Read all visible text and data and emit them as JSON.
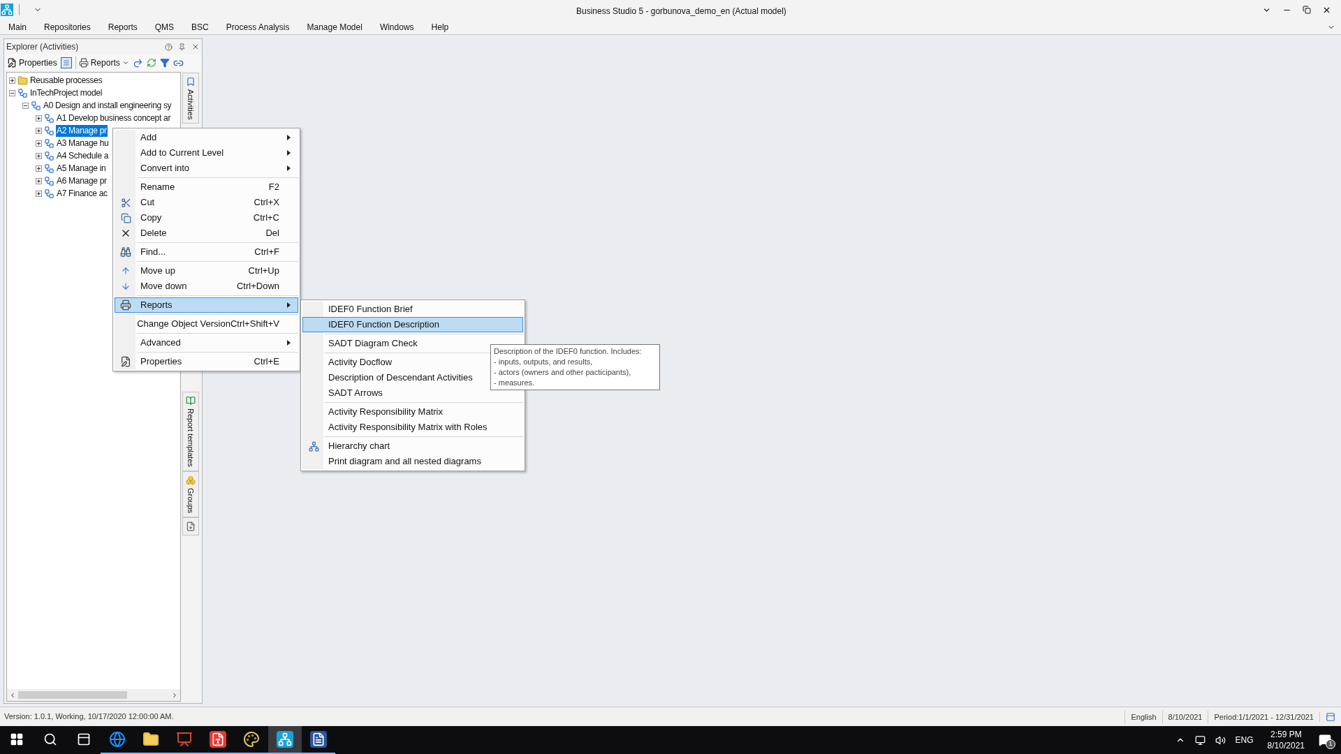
{
  "window": {
    "title": "Business Studio 5 - gorbunova_demo_en (Actual model)"
  },
  "menu_bar": [
    "Main",
    "Repositories",
    "Reports",
    "QMS",
    "BSC",
    "Process Analysis",
    "Manage Model",
    "Windows",
    "Help"
  ],
  "explorer": {
    "title": "Explorer (Activities)",
    "toolbar": [
      {
        "kind": "button",
        "label": "Properties"
      },
      {
        "kind": "icon"
      },
      {
        "kind": "dropdown",
        "label": "Reports"
      },
      {
        "kind": "icon"
      },
      {
        "kind": "icon"
      },
      {
        "kind": "icon"
      },
      {
        "kind": "icon"
      }
    ],
    "tree": [
      {
        "label": "Reusable processes",
        "expanded": false,
        "selected": false
      },
      {
        "label": "InTechProject model",
        "expanded": true,
        "selected": false,
        "children": [
          {
            "label": "A0 Design and install engineering sy",
            "expanded": true,
            "selected": false,
            "children": [
              {
                "label": "A1 Develop business concept ar",
                "expanded": false,
                "selected": false
              },
              {
                "label": "A2 Manage pr",
                "expanded": false,
                "selected": true
              },
              {
                "label": "A3 Manage hu",
                "expanded": false,
                "selected": false
              },
              {
                "label": "A4 Schedule a",
                "expanded": false,
                "selected": false
              },
              {
                "label": "A5 Manage in",
                "expanded": false,
                "selected": false
              },
              {
                "label": "A6 Manage pr",
                "expanded": false,
                "selected": false
              },
              {
                "label": "A7 Finance ac",
                "expanded": false,
                "selected": false
              }
            ]
          }
        ]
      }
    ],
    "side_tabs": [
      {
        "label": "Activities"
      },
      {
        "label": "Report templates"
      },
      {
        "label": "Groups"
      }
    ]
  },
  "context_menu": [
    {
      "kind": "item",
      "label": "Add",
      "submenu": true,
      "selected": false
    },
    {
      "kind": "item",
      "label": "Add to Current Level",
      "submenu": true,
      "selected": false
    },
    {
      "kind": "item",
      "label": "Convert into",
      "submenu": true,
      "selected": false
    },
    {
      "kind": "separator"
    },
    {
      "kind": "item",
      "label": "Rename",
      "shortcut": "F2",
      "selected": false
    },
    {
      "kind": "item",
      "label": "Cut",
      "shortcut": "Ctrl+X",
      "selected": false
    },
    {
      "kind": "item",
      "label": "Copy",
      "shortcut": "Ctrl+C",
      "selected": false
    },
    {
      "kind": "item",
      "label": "Delete",
      "shortcut": "Del",
      "selected": false
    },
    {
      "kind": "separator"
    },
    {
      "kind": "item",
      "label": "Find...",
      "shortcut": "Ctrl+F",
      "selected": false
    },
    {
      "kind": "separator"
    },
    {
      "kind": "item",
      "label": "Move up",
      "shortcut": "Ctrl+Up",
      "selected": false
    },
    {
      "kind": "item",
      "label": "Move down",
      "shortcut": "Ctrl+Down",
      "selected": false
    },
    {
      "kind": "separator"
    },
    {
      "kind": "item",
      "label": "Reports",
      "submenu": true,
      "selected": true
    },
    {
      "kind": "separator"
    },
    {
      "kind": "item",
      "label": "Change Object Version",
      "shortcut": "Ctrl+Shift+V",
      "selected": false
    },
    {
      "kind": "separator"
    },
    {
      "kind": "item",
      "label": "Advanced",
      "submenu": true,
      "selected": false
    },
    {
      "kind": "separator"
    },
    {
      "kind": "item",
      "label": "Properties",
      "shortcut": "Ctrl+E",
      "selected": false
    }
  ],
  "reports_submenu": [
    {
      "kind": "item",
      "label": "IDEF0 Function Brief",
      "selected": false
    },
    {
      "kind": "item",
      "label": "IDEF0 Function Description",
      "selected": true
    },
    {
      "kind": "separator"
    },
    {
      "kind": "item",
      "label": "SADT Diagram Check",
      "selected": false
    },
    {
      "kind": "separator"
    },
    {
      "kind": "item",
      "label": "Activity Docflow",
      "selected": false
    },
    {
      "kind": "item",
      "label": "Description of Descendant Activities",
      "selected": false
    },
    {
      "kind": "item",
      "label": "SADT Arrows",
      "selected": false
    },
    {
      "kind": "separator"
    },
    {
      "kind": "item",
      "label": "Activity Responsibility Matrix",
      "selected": false
    },
    {
      "kind": "item",
      "label": "Activity Responsibility Matrix with Roles",
      "selected": false
    },
    {
      "kind": "separator"
    },
    {
      "kind": "item",
      "label": "Hierarchy chart",
      "selected": false
    },
    {
      "kind": "item",
      "label": "Print diagram and all nested diagrams",
      "selected": false
    }
  ],
  "tooltip": [
    "Description of the IDEF0 function. Includes:",
    "- inputs, outputs, and results,",
    "- actors (owners and other pacticipants),",
    "- measures."
  ],
  "status_bar": {
    "text": "Version: 1.0.1, Working, 10/17/2020 12:00:00 AM.",
    "fields": [
      "English",
      "8/10/2021",
      "Period:1/1/2021 - 12/31/2021"
    ]
  },
  "taskbar": {
    "apps": [
      {
        "running": false,
        "selected": false
      },
      {
        "running": false,
        "selected": false
      },
      {
        "running": false,
        "selected": false
      },
      {
        "running": true,
        "selected": false
      },
      {
        "running": true,
        "selected": false
      },
      {
        "running": true,
        "selected": false
      },
      {
        "running": true,
        "selected": false
      },
      {
        "running": true,
        "selected": false
      },
      {
        "running": true,
        "selected": true
      },
      {
        "running": true,
        "selected": false
      }
    ],
    "language": "ENG",
    "time": "2:59 PM",
    "date": "8/10/2021",
    "notifications": "1"
  }
}
